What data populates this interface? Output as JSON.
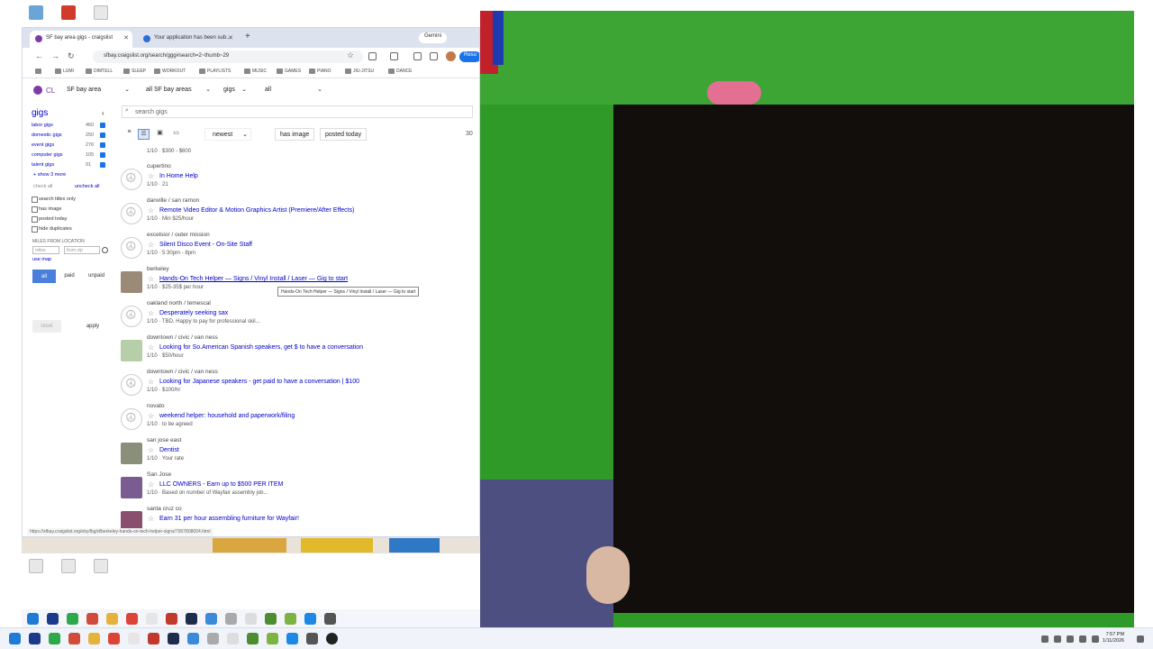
{
  "browser": {
    "tabs": [
      {
        "label": "SF bay area gigs - craigslist",
        "active": true
      },
      {
        "label": "Your application has been sub...",
        "active": false
      }
    ],
    "gemini_label": "Gemini",
    "url": "sfbay.craigslist.org/search/ggg#search=2~thumb~29",
    "resume_label": "Resu",
    "bookmarks": [
      "LUMI",
      "DIMTELL",
      "SLEEP",
      "WORKOUT",
      "PLAYLISTS",
      "MUSIC",
      "GAMES",
      "PIANO",
      "JIU-JITSU",
      "DANCE"
    ],
    "status_url": "https://sfbay.craigslist.org/eby/lbg/d/berkeley-hands-on-tech-helper-signs/7907808004.html"
  },
  "cl_header": {
    "logo_text": "CL",
    "area": "SF bay area",
    "subarea": "all SF bay areas",
    "category": "gigs",
    "subcategory": "all"
  },
  "sidebar": {
    "title": "gigs",
    "categories": [
      {
        "label": "labor gigs",
        "count": "460"
      },
      {
        "label": "domestic gigs",
        "count": "250"
      },
      {
        "label": "event gigs",
        "count": "276"
      },
      {
        "label": "computer gigs",
        "count": "105"
      },
      {
        "label": "talent gigs",
        "count": "91"
      }
    ],
    "show_more": "+ show 3 more",
    "check_all": "check all",
    "uncheck_all": "uncheck all",
    "options": [
      "search titles only",
      "has image",
      "posted today",
      "hide duplicates"
    ],
    "miles_heading": "MILES FROM LOCATION",
    "miles_placeholder": "miles",
    "from_zip_placeholder": "from zip",
    "use_map": "use map",
    "pay_filters": [
      "all",
      "paid",
      "unpaid"
    ],
    "reset_label": "reset",
    "apply_label": "apply"
  },
  "search": {
    "placeholder": "search gigs"
  },
  "controls": {
    "view_icons": [
      "list-icon",
      "gallery-icon",
      "preview-icon",
      "grid-icon"
    ],
    "sort": "newest",
    "has_image": "has image",
    "posted_today": "posted today",
    "count": "30"
  },
  "listings": [
    {
      "location": "",
      "title": "",
      "meta": "1/10 · $300 - $600"
    },
    {
      "location": "cupertino",
      "title": "In Home Help",
      "meta": "1/10 · 21"
    },
    {
      "location": "danville / san ramon",
      "title": "Remote Video Editor & Motion Graphics Artist (Premiere/After Effects)",
      "meta": "1/10 · Min $25/hour"
    },
    {
      "location": "excelsior / outer mission",
      "title": "Silent Disco Event - On-Site Staff",
      "meta": "1/10 · 5:30pm - 8pm"
    },
    {
      "location": "berkeley",
      "title": "Hands-On Tech Helper — Signs / Vinyl Install / Laser — Gig to start",
      "meta": "1/10 · $25-35$ per hour"
    },
    {
      "location": "oakland north / temescal",
      "title": "Desperately seeking sax",
      "meta": "1/10 · TBD. Happy to pay for professional skil..."
    },
    {
      "location": "downtown / civic / van ness",
      "title": "Looking for So.American Spanish speakers, get $ to have a conversation",
      "meta": "1/10 · $50/hour"
    },
    {
      "location": "downtown / civic / van ness",
      "title": "Looking for Japanese speakers - get paid to have a conversation | $100",
      "meta": "1/10 · $100/hr"
    },
    {
      "location": "novato",
      "title": "weekend helper: household and paperwork/filing",
      "meta": "1/10 · to be agreed"
    },
    {
      "location": "san jose east",
      "title": "Dentist",
      "meta": "1/10 · Your rate"
    },
    {
      "location": "San Jose",
      "title": "LLC OWNERS - Earn up to $500 PER ITEM",
      "meta": "1/10 · Based on number of Wayfair assembly job..."
    },
    {
      "location": "santa cruz co",
      "title": "Earn 31 per hour assembling furniture for Wayfair!",
      "meta": ""
    }
  ],
  "tooltip": "Hands-On Tech Helper — Signs / Vinyl Install / Laser — Gig to start",
  "taskbar": {
    "time": "7:57 PM",
    "date": "1/11/2026"
  },
  "colors": {
    "link": "#0000cc",
    "craigslist_purple": "#7b3ca7",
    "greenscreen": "#2f9a28",
    "active_pill": "#4a7fdb"
  }
}
